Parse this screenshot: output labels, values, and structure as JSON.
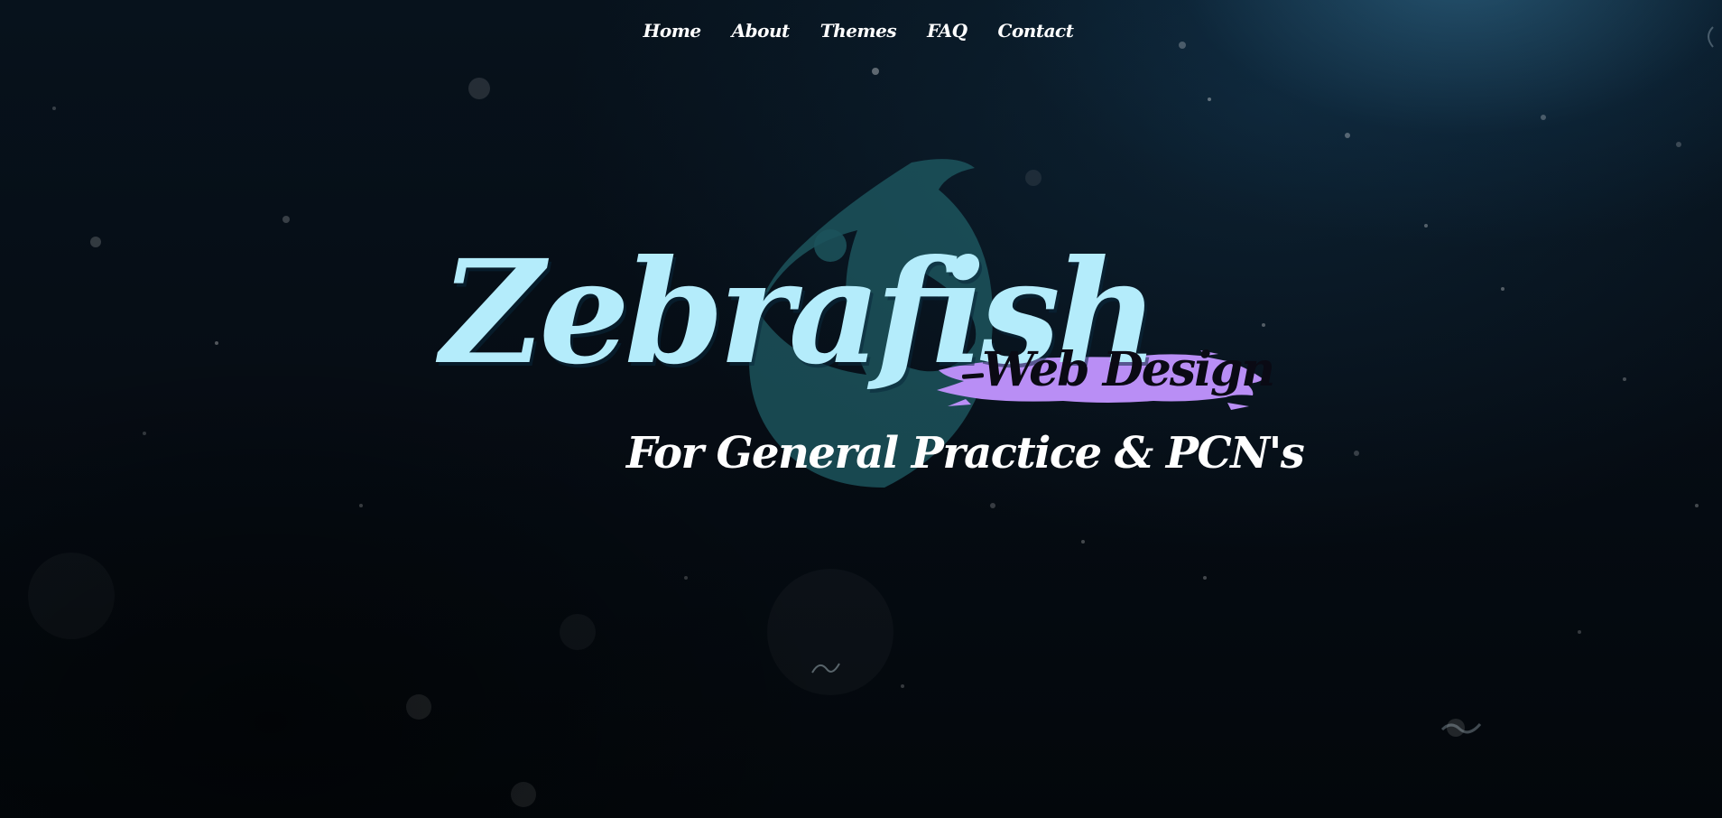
{
  "nav": {
    "items": [
      {
        "label": "Home"
      },
      {
        "label": "About"
      },
      {
        "label": "Themes"
      },
      {
        "label": "FAQ"
      },
      {
        "label": "Contact"
      }
    ]
  },
  "hero": {
    "title": "Zebrafish",
    "tagline": "Web Design",
    "subtitle": "For General Practice & PCN's",
    "logo_icon": "fish-icon"
  },
  "colors": {
    "title": "#b4ecfb",
    "brush": "#b98ef5",
    "logo": "#1f5a63",
    "background": "#050b12",
    "nav_text": "#ffffff"
  }
}
